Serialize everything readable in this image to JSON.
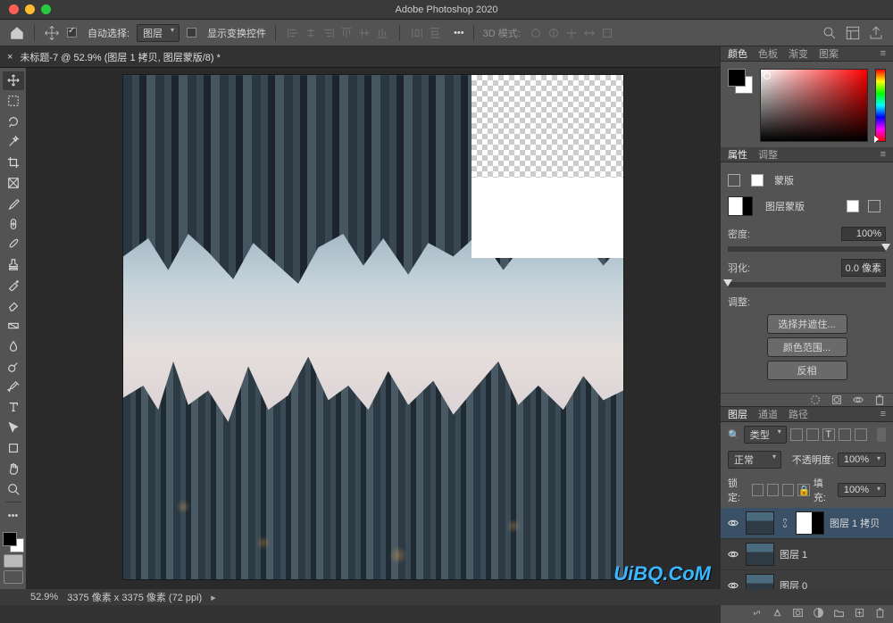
{
  "app_title": "Adobe Photoshop 2020",
  "options": {
    "auto_select_label": "自动选择:",
    "layer_dropdown": "图层",
    "show_transform_label": "显示变换控件",
    "mode_label": "3D 模式:"
  },
  "document": {
    "tab_title": "未标题-7 @ 52.9% (图层 1 拷贝, 图层蒙版/8) *"
  },
  "panels": {
    "color": {
      "tabs": [
        "颜色",
        "色板",
        "渐变",
        "图案"
      ],
      "active": "颜色"
    },
    "properties": {
      "tabs": [
        "属性",
        "调整"
      ],
      "active": "属性",
      "kind_label": "蒙版",
      "mask_label": "图层蒙版",
      "density_label": "密度:",
      "density_value": "100%",
      "feather_label": "羽化:",
      "feather_value": "0.0 像素",
      "adjust_label": "调整:",
      "btn_select": "选择并遮住...",
      "btn_range": "颜色范围...",
      "btn_invert": "反相"
    },
    "layers": {
      "tabs": [
        "图层",
        "通道",
        "路径"
      ],
      "active": "图层",
      "kind_label": "类型",
      "blend_mode": "正常",
      "opacity_label": "不透明度:",
      "opacity_value": "100%",
      "lock_label": "锁定:",
      "fill_label": "填充:",
      "fill_value": "100%",
      "items": [
        {
          "name": "图层 1 拷贝",
          "selected": true,
          "has_mask": true
        },
        {
          "name": "图层 1",
          "selected": false,
          "has_mask": false
        },
        {
          "name": "图层 0",
          "selected": false,
          "has_mask": false
        }
      ]
    }
  },
  "status": {
    "zoom": "52.9%",
    "doc_size": "3375 像素 x 3375 像素 (72 ppi)"
  },
  "watermark": "UiBQ.CoM"
}
